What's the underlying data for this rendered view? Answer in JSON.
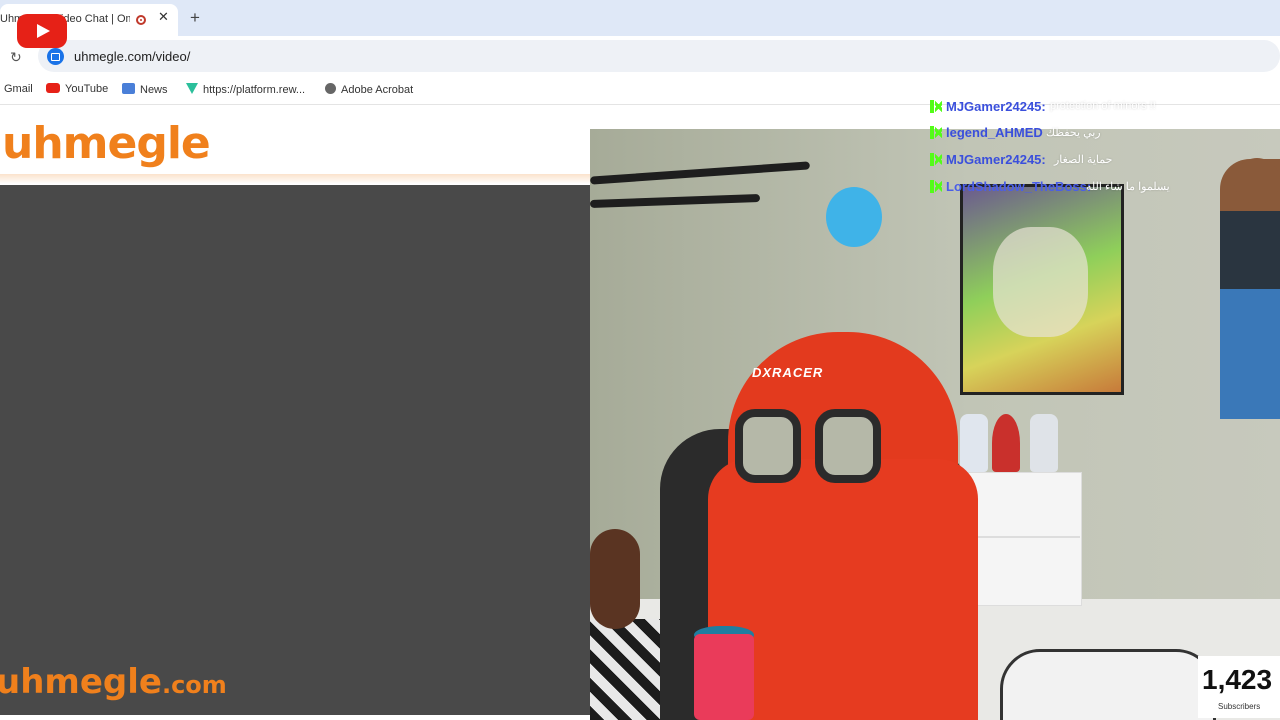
{
  "browser": {
    "tab_title": "Uhmegle - Video Chat | Omegle",
    "new_tab_symbol": "+",
    "close_symbol": "✕",
    "reload_symbol": "↻",
    "url": "uhmegle.com/video/"
  },
  "bookmarks": [
    {
      "label": "Gmail",
      "icon": "gmail-icon"
    },
    {
      "label": "YouTube",
      "icon": "youtube-icon"
    },
    {
      "label": "News",
      "icon": "news-icon"
    },
    {
      "label": "https://platform.rew...",
      "icon": "platform-icon"
    },
    {
      "label": "Adobe Acrobat",
      "icon": "globe-icon"
    }
  ],
  "page": {
    "logo": "uhmegle",
    "watermark": "uhmegle",
    "watermark_tld": ".com"
  },
  "webcam": {
    "chair_brand": "DXRACER"
  },
  "chat": [
    {
      "user": "MJGamer24245:",
      "message": "protection of minors !!"
    },
    {
      "user": "legend_AHMED",
      "message": "ربي يحفظك"
    },
    {
      "user": "MJGamer24245:",
      "message": "حماية الصغار"
    },
    {
      "user": "LordShadow_TheBoss:",
      "message": "يسلموا ما شاء الله"
    }
  ],
  "subscribers": {
    "count": "1,423",
    "label": "Subscribers"
  },
  "colors": {
    "brand_orange": "#f0801c",
    "chat_user": "#3a4fdc",
    "kick_green": "#53fc18",
    "youtube_red": "#e62117"
  }
}
